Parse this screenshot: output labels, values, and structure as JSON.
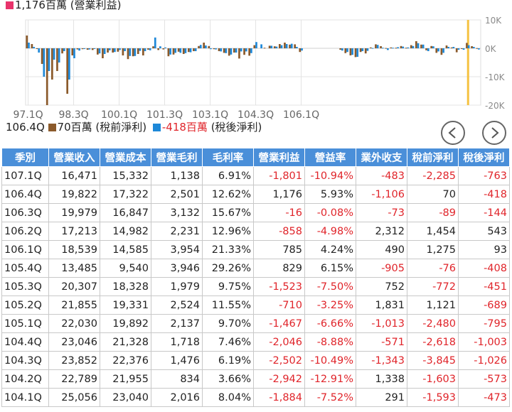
{
  "legend_top": {
    "operating_income_text": "1,176百萬 (營業利益)",
    "operating_income_color": "#e8336b"
  },
  "legend_bottom": {
    "pretax_quarter": "106.4Q",
    "pretax_text": "70百萬 (稅前淨利)",
    "pretax_color": "#8b5a2b",
    "aftertax_value": "-418百萬",
    "aftertax_label": " (稅後淨利)",
    "aftertax_color": "#1e88d8"
  },
  "nav": {
    "prev_icon": "chevron-left-icon",
    "next_icon": "chevron-right-icon"
  },
  "chart_data": {
    "type": "bar",
    "x_tick_labels": [
      "97.1Q",
      "98.3Q",
      "100.1Q",
      "101.3Q",
      "103.1Q",
      "104.3Q",
      "106.1Q"
    ],
    "y_tick_labels": [
      "10K",
      "0K",
      "-10K",
      "-20K"
    ],
    "yticks": [
      10000,
      0,
      -10000,
      -20000
    ],
    "ylim": [
      -20000,
      10000
    ],
    "grid": true,
    "highlight_color": "#f5c242",
    "series_colors": {
      "pretax": "#8b5a2b",
      "aftertax": "#1e88d8"
    },
    "series": [
      {
        "name": "稅前淨利",
        "values": [
          4500,
          1500,
          -200,
          -5500,
          -20000,
          -11000,
          -8000,
          -1800,
          -16000,
          -2500,
          -400,
          -300,
          -500,
          -600,
          -2200,
          -3500,
          -1500,
          -1500,
          -1200,
          -2500,
          -3800,
          -2800,
          -2000,
          -2500,
          -500,
          700,
          -600,
          -400,
          -2800,
          -2200,
          -1200,
          -2000,
          -1300,
          -1000,
          800,
          2000,
          800,
          -300,
          -1000,
          -1600,
          -2600,
          -1500,
          -3600,
          -2300,
          -2600,
          1100,
          0,
          200,
          900,
          700,
          1500,
          2000,
          1300,
          1400,
          -1300,
          0,
          0,
          0,
          0,
          0,
          0,
          0,
          -500,
          -1700,
          -2500,
          -3100,
          -1300,
          -1800,
          300,
          1400,
          750,
          100,
          300,
          200,
          800,
          200,
          1100,
          2500,
          1300,
          -700,
          800,
          -1600,
          -2300,
          1000,
          300,
          -1400,
          -100,
          1900,
          750,
          70
        ]
      },
      {
        "name": "稅後淨利",
        "values": [
          2000,
          500,
          -1500,
          -10000,
          -8000,
          -4000,
          -5000,
          -1000,
          -11000,
          -3500,
          -800,
          -200,
          -400,
          -100,
          -1800,
          -2000,
          -700,
          -1300,
          -600,
          -1000,
          -2700,
          -2700,
          -900,
          -1000,
          -700,
          3800,
          700,
          300,
          -2200,
          -1600,
          -1600,
          -1700,
          -1400,
          -1000,
          1200,
          1000,
          -300,
          -400,
          -1100,
          -1700,
          -2200,
          -1500,
          -1100,
          -1100,
          -1700,
          2200,
          1400,
          0,
          900,
          600,
          1100,
          1500,
          1600,
          500,
          -800,
          0,
          0,
          0,
          0,
          0,
          0,
          0,
          -800,
          -1300,
          -2300,
          -3000,
          -1000,
          -900,
          100,
          1200,
          200,
          -600,
          200,
          400,
          600,
          300,
          800,
          1800,
          1300,
          -1000,
          700,
          -1100,
          -1600,
          500,
          500,
          -500,
          -500,
          1100,
          500,
          -418
        ]
      }
    ]
  },
  "table": {
    "headers": [
      "季別",
      "營業收入",
      "營業成本",
      "營業毛利",
      "毛利率",
      "營業利益",
      "營益率",
      "業外收支",
      "稅前淨利",
      "稅後淨利"
    ],
    "rows": [
      [
        "107.1Q",
        "16,471",
        "15,332",
        "1,138",
        "6.91%",
        "-1,801",
        "-10.94%",
        "-483",
        "-2,285",
        "-763"
      ],
      [
        "106.4Q",
        "19,822",
        "17,322",
        "2,501",
        "12.62%",
        "1,176",
        "5.93%",
        "-1,106",
        "70",
        "-418"
      ],
      [
        "106.3Q",
        "19,979",
        "16,847",
        "3,132",
        "15.67%",
        "-16",
        "-0.08%",
        "-73",
        "-89",
        "-144"
      ],
      [
        "106.2Q",
        "17,213",
        "14,982",
        "2,231",
        "12.96%",
        "-858",
        "-4.98%",
        "2,312",
        "1,454",
        "543"
      ],
      [
        "106.1Q",
        "18,539",
        "14,585",
        "3,954",
        "21.33%",
        "785",
        "4.24%",
        "490",
        "1,275",
        "93"
      ],
      [
        "105.4Q",
        "13,485",
        "9,540",
        "3,946",
        "29.26%",
        "829",
        "6.15%",
        "-905",
        "-76",
        "-408"
      ],
      [
        "105.3Q",
        "20,307",
        "18,328",
        "1,979",
        "9.75%",
        "-1,523",
        "-7.50%",
        "752",
        "-772",
        "-451"
      ],
      [
        "105.2Q",
        "21,855",
        "19,331",
        "2,524",
        "11.55%",
        "-710",
        "-3.25%",
        "1,831",
        "1,121",
        "-689"
      ],
      [
        "105.1Q",
        "22,030",
        "19,892",
        "2,137",
        "9.70%",
        "-1,467",
        "-6.66%",
        "-1,013",
        "-2,480",
        "-795"
      ],
      [
        "104.4Q",
        "23,046",
        "21,328",
        "1,718",
        "7.46%",
        "-2,046",
        "-8.88%",
        "-571",
        "-2,618",
        "-1,003"
      ],
      [
        "104.3Q",
        "23,852",
        "22,376",
        "1,476",
        "6.19%",
        "-2,502",
        "-10.49%",
        "-1,343",
        "-3,845",
        "-1,026"
      ],
      [
        "104.2Q",
        "22,789",
        "21,955",
        "834",
        "3.66%",
        "-2,942",
        "-12.91%",
        "1,338",
        "-1,603",
        "-573"
      ],
      [
        "104.1Q",
        "25,056",
        "23,040",
        "2,016",
        "8.04%",
        "-1,884",
        "-7.52%",
        "291",
        "-1,593",
        "-473"
      ]
    ]
  }
}
